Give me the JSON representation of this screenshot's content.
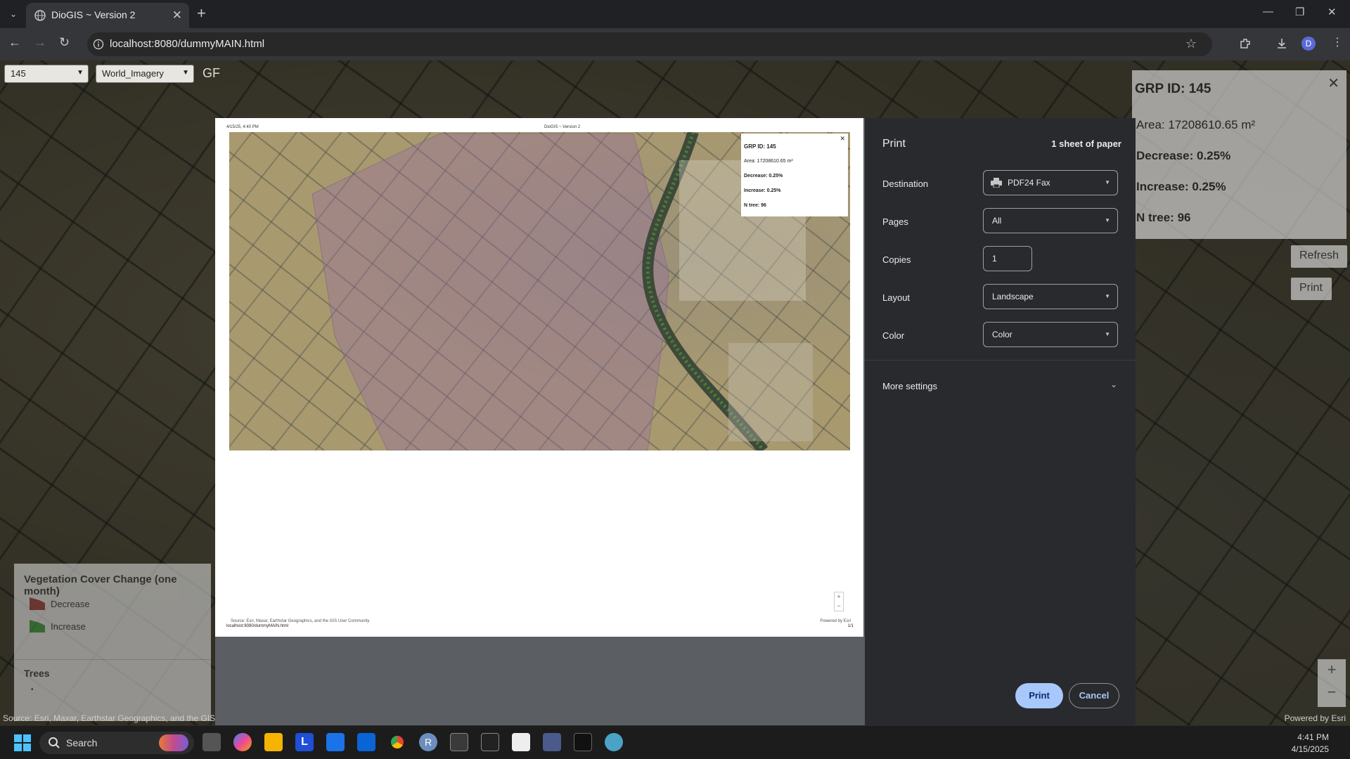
{
  "browser": {
    "tab_title": "DioGIS ~ Version 2",
    "url": "localhost:8080/dummyMAIN.html",
    "profile_initial": "D"
  },
  "map": {
    "grp_select": "145",
    "basemap_select": "World_Imagery",
    "gf_text": "GF",
    "popup": {
      "title": "GRP ID: 145",
      "area": "Area: 17208610.65 m²",
      "decrease": "Decrease: 0.25%",
      "increase": "Increase: 0.25%",
      "ntree": "N tree: 96"
    },
    "refresh_label": "Refresh",
    "print_label": "Print",
    "legend": {
      "title": "Vegetation Cover Change (one month)",
      "items": [
        {
          "label": "Decrease",
          "color": "#8b3a3a"
        },
        {
          "label": "Increase",
          "color": "#3c8c3c"
        }
      ],
      "trees_title": "Trees"
    },
    "attribution": "Source: Esri, Maxar, Earthstar Geographics, and the GIS User Community",
    "powered": "Powered by Esri"
  },
  "preview": {
    "date": "4/15/25, 4:40 PM",
    "title": "DioGIS ~ Version 2",
    "popup": {
      "title": "GRP ID: 145",
      "area": "Area: 17208610.65 m²",
      "decrease": "Decrease: 0.25%",
      "increase": "Increase: 0.25%",
      "ntree": "N tree: 96"
    },
    "source": "Source: Esri, Maxar, Earthstar Geographics, and the GIS User Community",
    "powered": "Powered by Esri",
    "url": "localhost:8080/dummyMAIN.html",
    "page": "1/1"
  },
  "print_panel": {
    "title": "Print",
    "sheets": "1 sheet of paper",
    "destination_label": "Destination",
    "destination_value": "PDF24 Fax",
    "pages_label": "Pages",
    "pages_value": "All",
    "copies_label": "Copies",
    "copies_value": "1",
    "layout_label": "Layout",
    "layout_value": "Landscape",
    "color_label": "Color",
    "color_value": "Color",
    "more_settings": "More settings",
    "print_button": "Print",
    "cancel_button": "Cancel"
  },
  "taskbar": {
    "search_label": "Search",
    "time": "4:41 PM",
    "date": "4/15/2025"
  }
}
